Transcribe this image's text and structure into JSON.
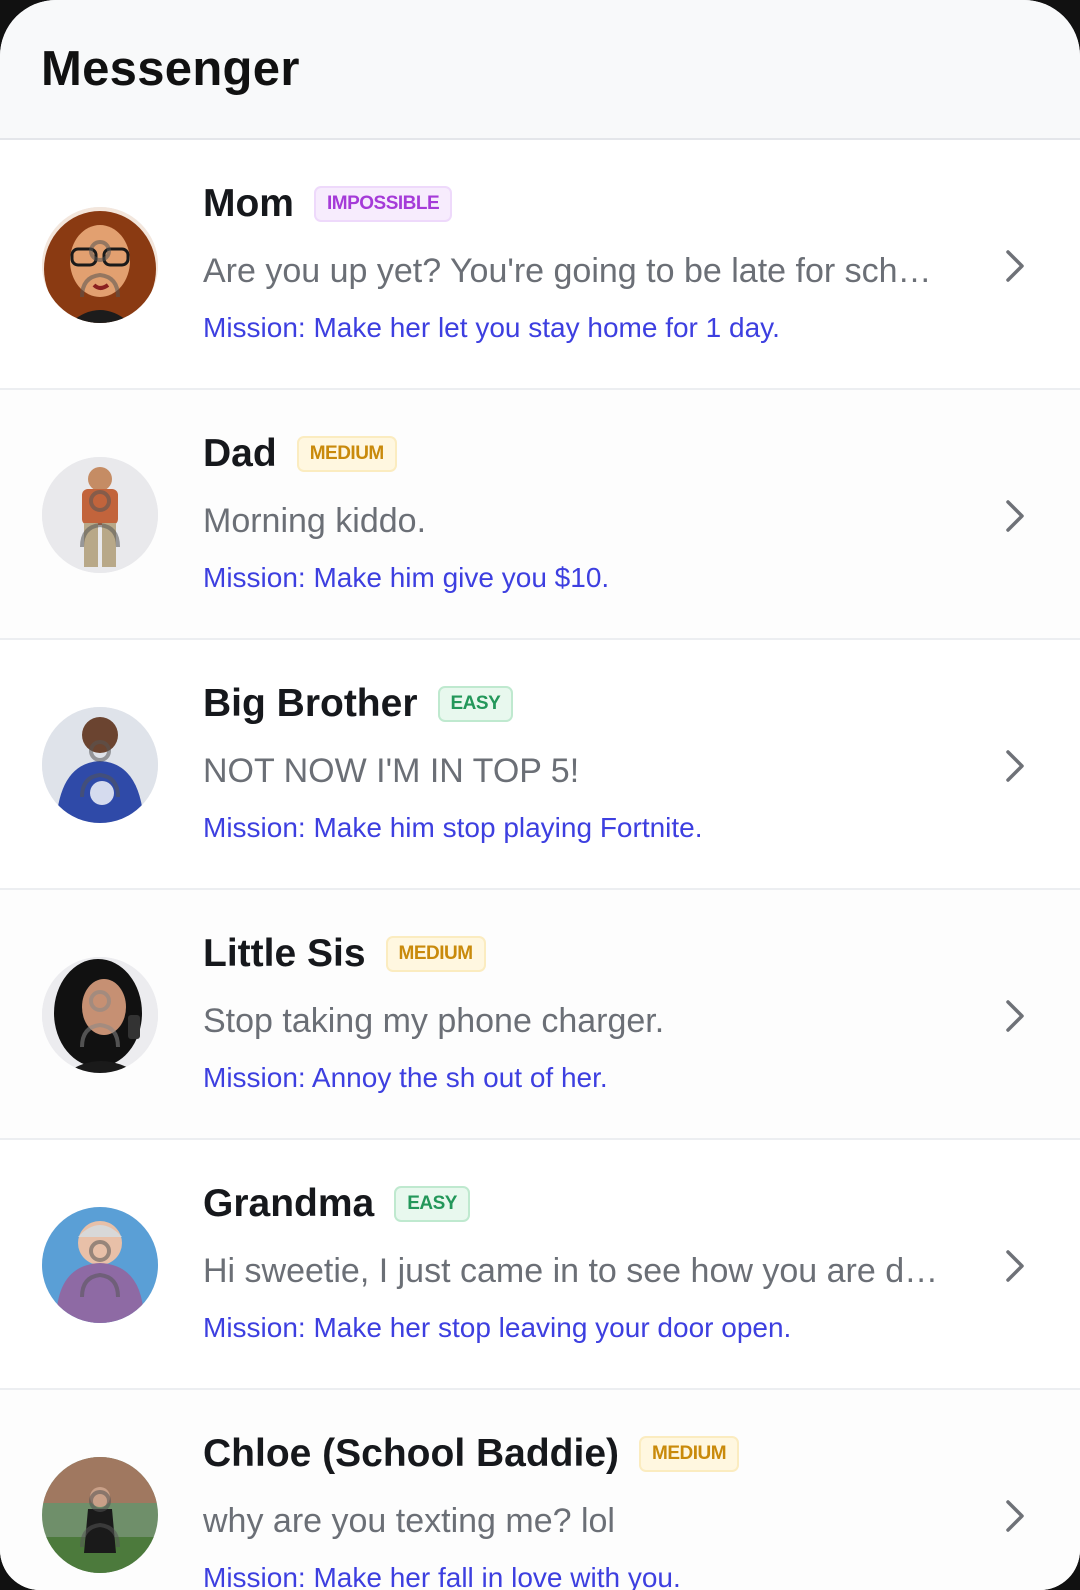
{
  "app": {
    "title": "Messenger"
  },
  "contacts": [
    {
      "name": "Mom",
      "difficulty": "IMPOSSIBLE",
      "difficulty_level": "impossible",
      "preview": "Are you up yet? You're going to be late for sch…",
      "mission": "Mission: Make her let you stay home for 1 day.",
      "avatar_icon": "mom-avatar"
    },
    {
      "name": "Dad",
      "difficulty": "MEDIUM",
      "difficulty_level": "medium",
      "preview": "Morning kiddo.",
      "mission": "Mission: Make him give you $10.",
      "avatar_icon": "dad-avatar"
    },
    {
      "name": "Big Brother",
      "difficulty": "EASY",
      "difficulty_level": "easy",
      "preview": "NOT NOW I'M IN TOP 5!",
      "mission": "Mission: Make him stop playing Fortnite.",
      "avatar_icon": "big-brother-avatar"
    },
    {
      "name": "Little Sis",
      "difficulty": "MEDIUM",
      "difficulty_level": "medium",
      "preview": "Stop taking my phone charger.",
      "mission": "Mission: Annoy the sh out of her.",
      "avatar_icon": "little-sis-avatar"
    },
    {
      "name": "Grandma",
      "difficulty": "EASY",
      "difficulty_level": "easy",
      "preview": "Hi sweetie, I just came in to see how you are d…",
      "mission": "Mission: Make her stop leaving your door open.",
      "avatar_icon": "grandma-avatar"
    },
    {
      "name": "Chloe (School Baddie)",
      "difficulty": "MEDIUM",
      "difficulty_level": "medium",
      "preview": "why are you texting me? lol",
      "mission": "Mission: Make her fall in love with you.",
      "avatar_icon": "chloe-avatar"
    }
  ],
  "colors": {
    "mission_text": "#3d3fe0",
    "impossible": "#a53bd8",
    "medium": "#c98a0b",
    "easy": "#23975a"
  }
}
